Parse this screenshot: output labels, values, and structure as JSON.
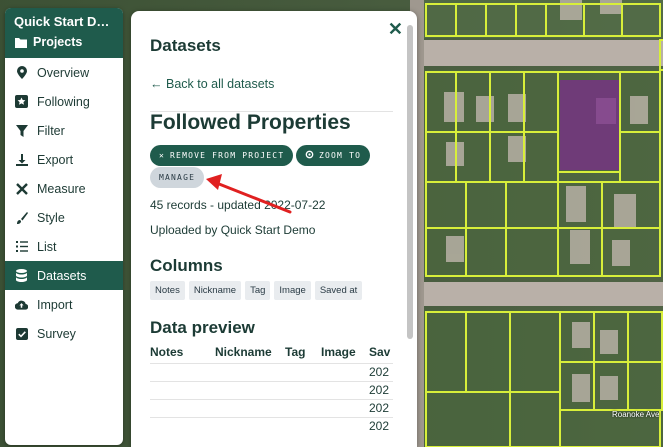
{
  "sidebar": {
    "app_title": "Quick Start De...",
    "projects_label": "Projects",
    "items": [
      {
        "label": "Overview",
        "icon": "map-pin-icon"
      },
      {
        "label": "Following",
        "icon": "star-icon"
      },
      {
        "label": "Filter",
        "icon": "filter-icon"
      },
      {
        "label": "Export",
        "icon": "download-icon"
      },
      {
        "label": "Measure",
        "icon": "ruler-icon"
      },
      {
        "label": "Style",
        "icon": "paintbrush-icon"
      },
      {
        "label": "List",
        "icon": "list-icon"
      },
      {
        "label": "Datasets",
        "icon": "database-icon",
        "active": true
      },
      {
        "label": "Import",
        "icon": "cloud-upload-icon"
      },
      {
        "label": "Survey",
        "icon": "checkbox-icon"
      }
    ]
  },
  "panel": {
    "title": "Datasets",
    "back_link": "Back to all datasets",
    "dataset_title": "Followed Properties",
    "buttons": {
      "remove": "REMOVE FROM PROJECT",
      "zoom": "ZOOM TO",
      "manage": "MANAGE"
    },
    "records_info": "45 records - updated 2022-07-22",
    "uploaded_by": "Uploaded by Quick Start Demo",
    "columns_heading": "Columns",
    "columns": [
      "Notes",
      "Nickname",
      "Tag",
      "Image",
      "Saved at"
    ],
    "preview_heading": "Data preview",
    "preview_headers": [
      "Notes",
      "Nickname",
      "Tag",
      "Image",
      "Sav"
    ],
    "preview_rows": [
      [
        "",
        "",
        "",
        "",
        "202"
      ],
      [
        "",
        "",
        "",
        "",
        "202"
      ],
      [
        "",
        "",
        "",
        "",
        "202"
      ],
      [
        "",
        "",
        "",
        "",
        "202"
      ]
    ]
  },
  "map": {
    "street_label": "Roanoke Ave",
    "parcel_outline_color": "#d8ef3a",
    "highlight_color": "#7b2d8b"
  },
  "colors": {
    "brand": "#1f5b4c",
    "arrow": "#e02020"
  }
}
